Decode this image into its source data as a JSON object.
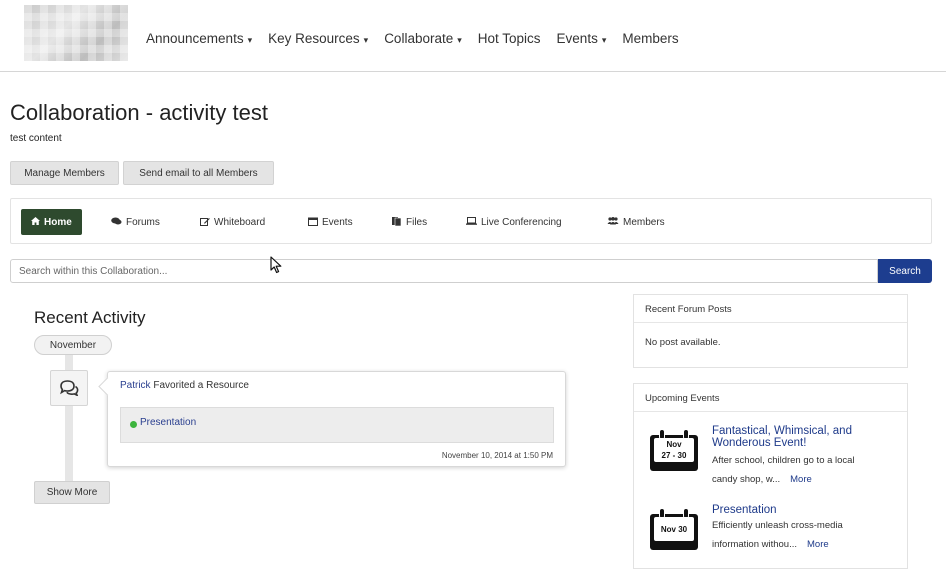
{
  "nav": {
    "items": [
      {
        "label": "Announcements",
        "dropdown": true
      },
      {
        "label": "Key Resources",
        "dropdown": true
      },
      {
        "label": "Collaborate",
        "dropdown": true
      },
      {
        "label": "Hot Topics",
        "dropdown": false
      },
      {
        "label": "Events",
        "dropdown": true
      },
      {
        "label": "Members",
        "dropdown": false
      }
    ]
  },
  "page": {
    "title": "Collaboration - activity test",
    "subtitle": "test content"
  },
  "actions": {
    "manage_members": "Manage Members",
    "send_email": "Send email to all Members"
  },
  "tabs": [
    {
      "label": "Home",
      "icon": "home-icon",
      "active": true
    },
    {
      "label": "Forums",
      "icon": "comments-icon",
      "active": false
    },
    {
      "label": "Whiteboard",
      "icon": "edit-icon",
      "active": false
    },
    {
      "label": "Events",
      "icon": "calendar-icon",
      "active": false
    },
    {
      "label": "Files",
      "icon": "files-icon",
      "active": false
    },
    {
      "label": "Live Conferencing",
      "icon": "laptop-icon",
      "active": false
    },
    {
      "label": "Members",
      "icon": "users-icon",
      "active": false
    }
  ],
  "search": {
    "placeholder": "Search within this Collaboration...",
    "button": "Search"
  },
  "activity": {
    "title": "Recent Activity",
    "month": "November",
    "items": [
      {
        "user": "Patrick",
        "action": " Favorited a Resource",
        "resource": "Presentation",
        "timestamp": "November 10, 2014 at 1:50 PM"
      }
    ],
    "show_more": "Show More"
  },
  "forum_posts": {
    "title": "Recent Forum Posts",
    "empty": "No post available."
  },
  "upcoming_events": {
    "title": "Upcoming Events",
    "events": [
      {
        "month": "Nov",
        "days": "27 - 30",
        "title": "Fantastical, Whimsical, and Wonderous Event!",
        "desc_line1": "After school, children go to a local",
        "desc_line2": "candy shop, w...",
        "more": "More"
      },
      {
        "month": "Nov 30",
        "days": "",
        "title": "Presentation",
        "desc_line1": "Efficiently unleash cross-media",
        "desc_line2": "information withou...",
        "more": "More"
      }
    ]
  },
  "colors": {
    "active_tab": "#2e4a2e",
    "search_button": "#1d3d8f",
    "link": "#1e3a8a",
    "status_dot": "#3db43d"
  }
}
